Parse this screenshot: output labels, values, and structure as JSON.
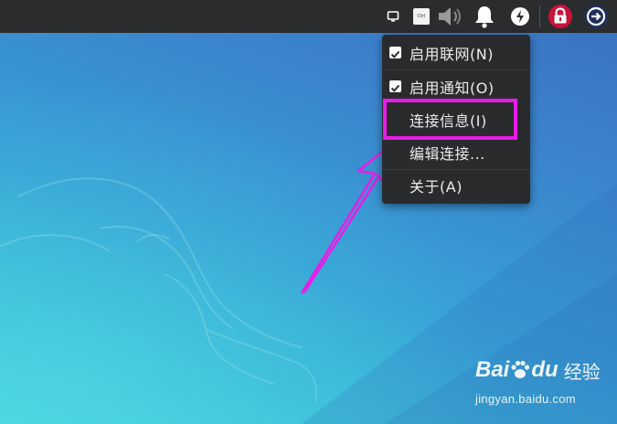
{
  "topbar": {
    "tray_icons": [
      {
        "name": "display-icon"
      },
      {
        "name": "keyboard-ctrl-icon",
        "label": "Ctrl"
      },
      {
        "name": "volume-icon"
      },
      {
        "name": "notification-bell-icon"
      },
      {
        "name": "power-icon"
      },
      {
        "name": "lock-icon"
      },
      {
        "name": "network-connection-icon"
      }
    ]
  },
  "menu": {
    "items": [
      {
        "label": "启用联网(N)",
        "checked": true
      },
      {
        "label": "启用通知(O)",
        "checked": true
      },
      {
        "label": "连接信息(I)",
        "checked": false,
        "highlighted": true
      },
      {
        "label": "编辑连接...",
        "checked": false
      },
      {
        "label": "关于(A)",
        "checked": false
      }
    ]
  },
  "annotation": {
    "highlight_color": "#e81ce8",
    "arrow_color": "#e81ce8"
  },
  "watermark": {
    "brand_a": "Bai",
    "brand_b": "du",
    "brand_cn": "经验",
    "url": "jingyan.baidu.com"
  },
  "colors": {
    "topbar": "#2b2c2e",
    "menu_bg": "#2a2b2d",
    "menu_text": "#ececec",
    "lock_badge": "#c8123a",
    "network_badge": "#1e2f5a"
  }
}
